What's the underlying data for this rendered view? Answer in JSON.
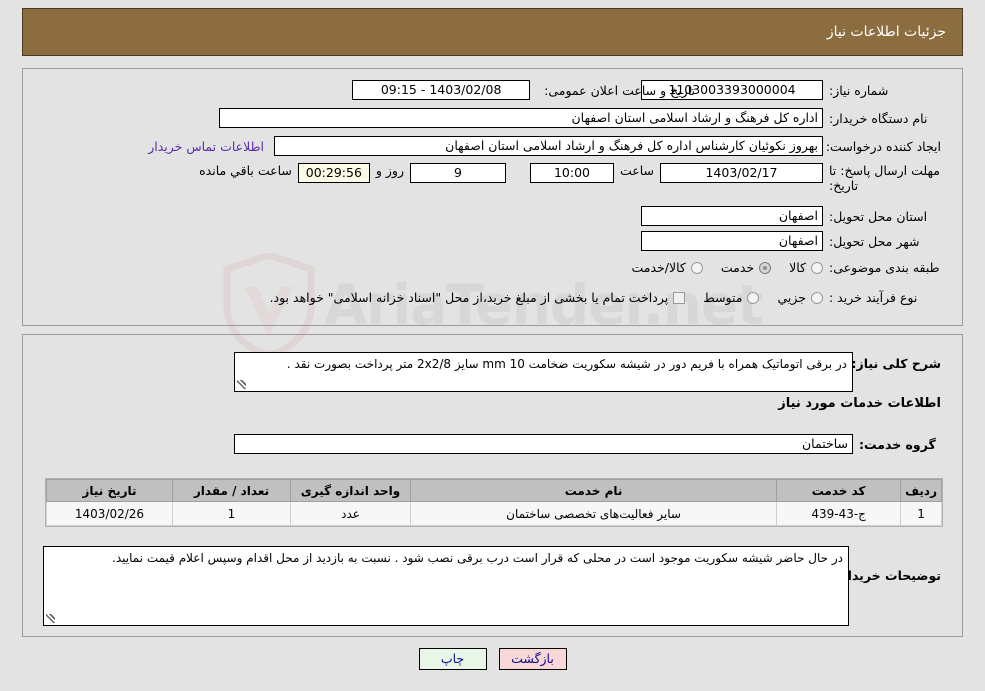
{
  "header": {
    "title": "جزئیات اطلاعات نیاز",
    "bar_color": "#8c6d40"
  },
  "watermark": {
    "text": "AriaTender.net"
  },
  "top_form": {
    "need_number_label": "شماره نیاز:",
    "need_number_value": "1103003393000004",
    "announce_label": "تاریخ و ساعت اعلان عمومی:",
    "announce_value": "1403/02/08 - 09:15",
    "buyer_org_label": "نام دستگاه خریدار:",
    "buyer_org_value": "اداره کل فرهنگ و ارشاد اسلامی استان اصفهان",
    "creator_label": "ایجاد کننده درخواست:",
    "creator_value": "بهروز نکوئیان کارشناس اداره کل فرهنگ و ارشاد اسلامی استان اصفهان",
    "contact_link": "اطلاعات تماس خریدار",
    "deadline_label_l1": "مهلت ارسال پاسخ: تا",
    "deadline_label_l2": "تاریخ:",
    "deadline_date": "1403/02/17",
    "hour_label": "ساعت",
    "deadline_time": "10:00",
    "days_value": "9",
    "days_label": "روز و",
    "countdown_value": "00:29:56",
    "countdown_label": "ساعت باقي مانده",
    "province_label": "استان محل تحویل:",
    "province_value": "اصفهان",
    "city_label": "شهر محل تحویل:",
    "city_value": "اصفهان",
    "category_label": "طبقه بندی موضوعی:",
    "category_options": [
      {
        "label": "کالا",
        "selected": false
      },
      {
        "label": "خدمت",
        "selected": true
      },
      {
        "label": "کالا/خدمت",
        "selected": false
      }
    ],
    "process_label": "نوع فرآیند خرید :",
    "process_options": [
      {
        "label": "جزیي",
        "selected": false
      },
      {
        "label": "متوسط",
        "selected": false
      }
    ],
    "treasury_checkbox_label": "پرداخت تمام یا بخشی از مبلغ خرید،از محل \"اسناد خزانه اسلامی\" خواهد بود.",
    "treasury_checked": false
  },
  "bottom_form": {
    "overall_desc_label": "شرح کلی نیاز:",
    "overall_desc_value": "در برقی اتوماتیک همراه با فریم دور در شیشه سکوریت ضخامت mm 10 سایز    2x2/8 متر پرداخت بصورت نقد .",
    "services_section_title": "اطلاعات خدمات مورد نیاز",
    "service_group_label": "گروه خدمت:",
    "service_group_value": "ساختمان",
    "buyer_notes_label": "توضیحات خریدار:",
    "buyer_notes_value": "در حال حاضر شیشه سکوریت موجود است در محلی که قرار است درب برقی نصب شود . نسبت به بازدید از محل اقدام وسپس اعلام قیمت نمایید."
  },
  "table": {
    "headers": [
      "ردیف",
      "کد خدمت",
      "نام خدمت",
      "واحد اندازه گیری",
      "تعداد / مقدار",
      "تاریخ نیاز"
    ],
    "rows": [
      {
        "radif": "1",
        "code": "ج-43-439",
        "name": "سایر فعالیت‌های تخصصی ساختمان",
        "unit": "عدد",
        "qty": "1",
        "date": "1403/02/26"
      }
    ]
  },
  "footer": {
    "back_label": "بازگشت",
    "print_label": "چاپ"
  }
}
